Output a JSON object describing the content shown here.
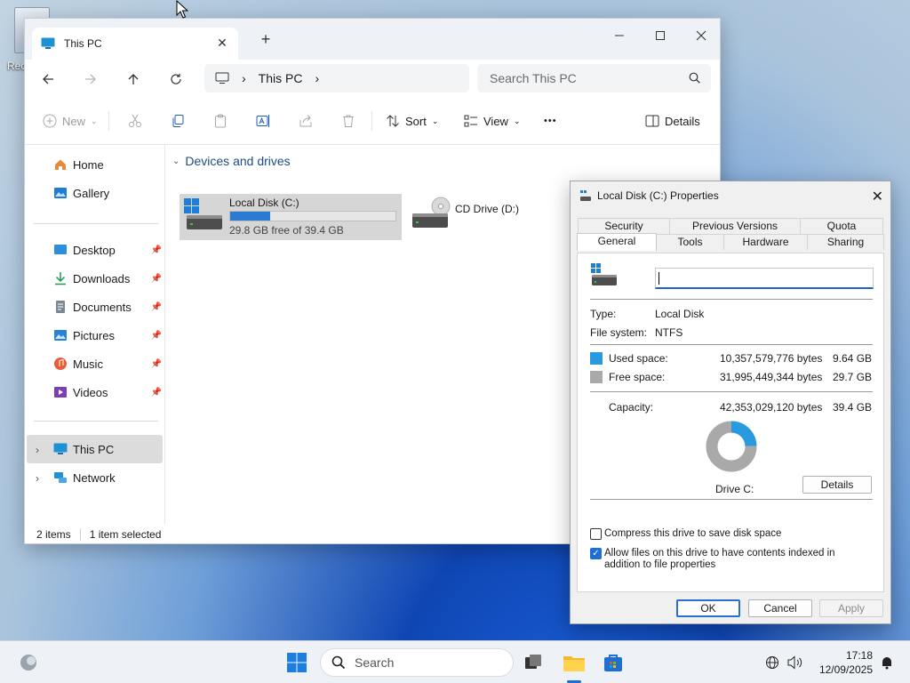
{
  "desktop": {
    "recycle_label": "Rec"
  },
  "explorer": {
    "tab_title": "This PC",
    "tab_close": "✕",
    "new_tab": "+",
    "address": {
      "location": "This PC"
    },
    "search": {
      "placeholder": "Search This PC"
    },
    "toolbar": {
      "new": "New",
      "sort": "Sort",
      "view": "View",
      "more": "•••",
      "details": "Details"
    },
    "sidebar": {
      "home": "Home",
      "gallery": "Gallery",
      "pinned": [
        {
          "label": "Desktop",
          "icon": "desktop-icon"
        },
        {
          "label": "Downloads",
          "icon": "downloads-icon"
        },
        {
          "label": "Documents",
          "icon": "documents-icon"
        },
        {
          "label": "Pictures",
          "icon": "pictures-icon"
        },
        {
          "label": "Music",
          "icon": "music-icon"
        },
        {
          "label": "Videos",
          "icon": "videos-icon"
        }
      ],
      "this_pc": "This PC",
      "network": "Network"
    },
    "group_header": "Devices and drives",
    "drives": [
      {
        "name": "Local Disk (C:)",
        "free_text": "29.8 GB free of 39.4 GB",
        "used_fraction": 0.24
      },
      {
        "name": "CD Drive (D:)"
      }
    ],
    "status": {
      "items": "2 items",
      "selected": "1 item selected"
    }
  },
  "properties": {
    "title": "Local Disk (C:) Properties",
    "close": "✕",
    "tabs_row1": [
      "Security",
      "Previous Versions",
      "Quota"
    ],
    "tabs_row2": [
      "General",
      "Tools",
      "Hardware",
      "Sharing"
    ],
    "active_tab": "General",
    "name_value": "",
    "type_label": "Type:",
    "type_value": "Local Disk",
    "fs_label": "File system:",
    "fs_value": "NTFS",
    "used": {
      "label": "Used space:",
      "bytes": "10,357,579,776 bytes",
      "size": "9.64 GB",
      "color": "#2a9ae0"
    },
    "free": {
      "label": "Free space:",
      "bytes": "31,995,449,344 bytes",
      "size": "29.7 GB",
      "color": "#a9a9a9"
    },
    "capacity": {
      "label": "Capacity:",
      "bytes": "42,353,029,120 bytes",
      "size": "39.4 GB"
    },
    "used_fraction": 0.245,
    "drive_label": "Drive C:",
    "details_btn": "Details",
    "compress_label": "Compress this drive to save disk space",
    "compress_checked": false,
    "index_label": "Allow files on this drive to have contents indexed in addition to file properties",
    "index_checked": true,
    "ok": "OK",
    "cancel": "Cancel",
    "apply": "Apply"
  },
  "taskbar": {
    "search_placeholder": "Search",
    "time": "17:18",
    "date": "12/09/2025"
  }
}
